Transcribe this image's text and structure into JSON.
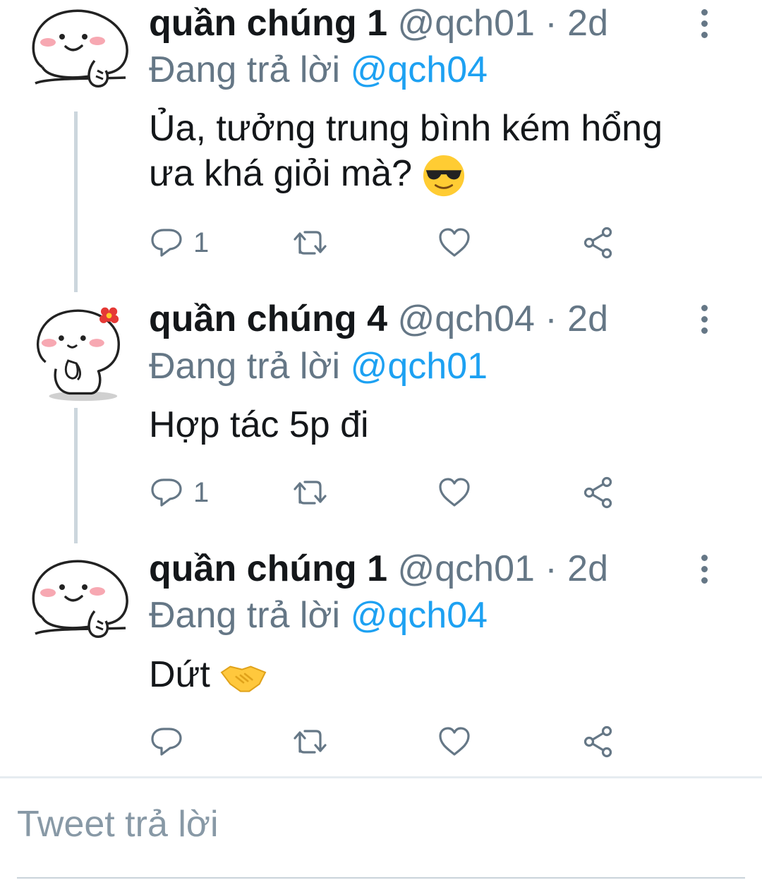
{
  "tweets": [
    {
      "name": "quần chúng 1",
      "handle": "@qch01",
      "sep": "·",
      "age": "2d",
      "replying_prefix": "Đang trả lời",
      "replying_to": "@qch04",
      "text": "Ủa, tưởng trung bình kém hổng ưa khá giỏi mà?",
      "emoji": "sunglasses-face",
      "reply_count": "1",
      "avatar": "smiling-bun-thinking"
    },
    {
      "name": "quần chúng 4",
      "handle": "@qch04",
      "sep": "·",
      "age": "2d",
      "replying_prefix": "Đang trả lời",
      "replying_to": "@qch01",
      "text": "Hợp tác 5p đi",
      "reply_count": "1",
      "avatar": "bun-with-flower-praying"
    },
    {
      "name": "quần chúng 1",
      "handle": "@qch01",
      "sep": "·",
      "age": "2d",
      "replying_prefix": "Đang trả lời",
      "replying_to": "@qch04",
      "text": "Dứt",
      "emoji": "handshake",
      "reply_count": "",
      "avatar": "smiling-bun-thinking"
    }
  ],
  "composer": {
    "placeholder": "Tweet trả lời"
  },
  "icons": {
    "reply": "speech-bubble-icon",
    "retweet": "retweet-icon",
    "like": "heart-icon",
    "share": "share-icon",
    "more": "vertical-ellipsis-icon"
  },
  "colors": {
    "accent": "#1da1f2",
    "muted": "#657786",
    "thread": "#ccd6dd"
  }
}
